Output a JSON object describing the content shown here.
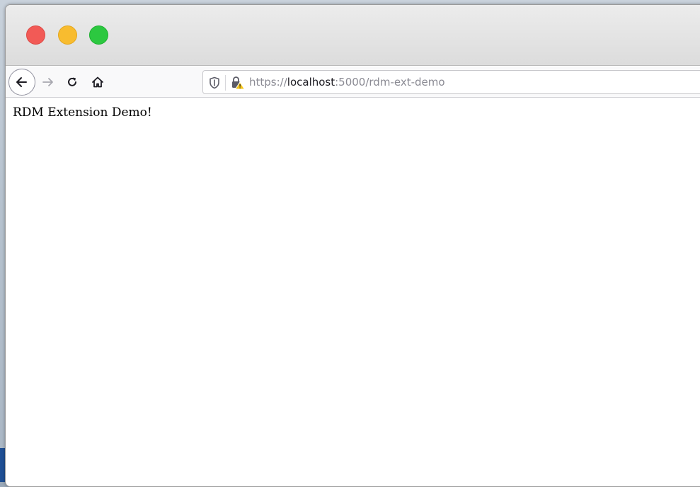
{
  "window": {
    "controls": {
      "close_color": "#f25a56",
      "minimize_color": "#f8bc2f",
      "maximize_color": "#2cc840"
    }
  },
  "navbar": {
    "back_icon": "arrow-left-icon",
    "forward_icon": "arrow-right-icon",
    "reload_icon": "reload-icon",
    "home_icon": "home-icon",
    "url": {
      "scheme": "https://",
      "host": "localhost",
      "rest": ":5000/rdm-ext-demo"
    },
    "shield_icon": "tracking-protection-shield-icon",
    "lock_icon": "insecure-lock-warning-icon"
  },
  "page": {
    "body_text": "RDM Extension Demo!"
  }
}
